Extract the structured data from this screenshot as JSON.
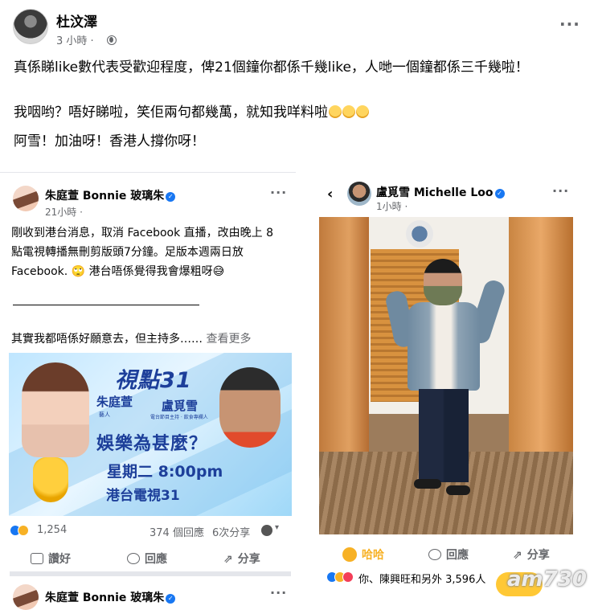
{
  "post": {
    "author": "杜汶澤",
    "time": "3 小時 ·",
    "more": "···",
    "line1": "真係睇like數代表受歡迎程度，俾21個鐘你都係千幾like，人哋一個鐘都係三千幾啦！",
    "line2": "我咽哟？唔好睇啦，笑佢兩句都幾萬，就知我咩料啦",
    "line3": "阿雪！加油呀！香港人撐你呀！"
  },
  "left_card": {
    "author": "朱庭萱 Bonnie 玻璃朱",
    "time": "21小時 ·",
    "more": "···",
    "body": "剛收到港台消息，取消 Facebook 直播，改由晚上 8點電視轉播無刪剪版頭7分鐘。足版本週兩日放 Facebook. 🙄 港台唔係覺得我會爆粗呀😅",
    "divider": "_______________________",
    "excerpt": "其實我都唔係好願意去，但主持多……",
    "see_more": "查看更多",
    "promo": {
      "logo": "視點31",
      "host1": "朱庭萱",
      "host1_role": "藝人",
      "host2": "盧覓雪",
      "host2_role": "電台節目主持 · 飲食專欄人",
      "title": "娛樂為甚麼？",
      "time": "星期二 8:00pm",
      "station": "港台電視31"
    },
    "reaction_count": "1,254",
    "comments": "374 個回應",
    "shares": "6次分享",
    "like_label": "讚好",
    "comment_label": "回應",
    "share_label": "分享",
    "next_author": "朱庭萱 Bonnie 玻璃朱"
  },
  "right_card": {
    "back": "‹",
    "author": "盧覓雪 Michelle Loo",
    "time": "1小時 ·",
    "more": "···",
    "haha_label": "哈哈",
    "comment_label": "回應",
    "share_label": "分享",
    "reaction_summary": "你、陳興旺和另外 3,596人",
    "watermark": "am730"
  },
  "colors": {
    "brand_blue": "#1877f2",
    "meta_gray": "#65676b",
    "haha_yellow": "#f7b125"
  }
}
